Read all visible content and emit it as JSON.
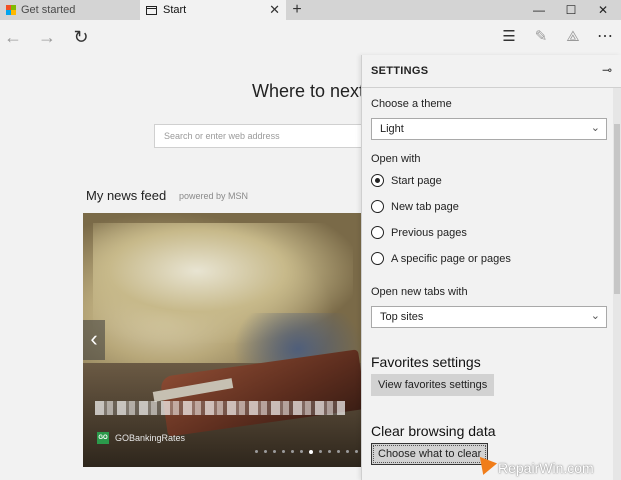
{
  "tabs": [
    {
      "label": "Get started"
    },
    {
      "label": "Start"
    }
  ],
  "window_controls": {
    "minimize": "—",
    "maximize": "☐",
    "close": "✕"
  },
  "newtab_glyph": "+",
  "start_page": {
    "heading": "Where to next?",
    "search_placeholder": "Search or enter web address",
    "feed_title": "My news feed",
    "powered_by": "powered by MSN",
    "hero_source": "GOBankingRates",
    "hero_source_badge": "GO",
    "carousel": {
      "count": 14,
      "active": 6
    }
  },
  "settings": {
    "title": "SETTINGS",
    "theme_label": "Choose a theme",
    "theme_value": "Light",
    "open_with_label": "Open with",
    "open_with_options": [
      {
        "label": "Start page",
        "selected": true
      },
      {
        "label": "New tab page",
        "selected": false
      },
      {
        "label": "Previous pages",
        "selected": false
      },
      {
        "label": "A specific page or pages",
        "selected": false
      }
    ],
    "new_tabs_label": "Open new tabs with",
    "new_tabs_value": "Top sites",
    "favorites_heading": "Favorites settings",
    "favorites_button": "View favorites settings",
    "clear_heading": "Clear browsing data",
    "clear_button": "Choose what to clear"
  },
  "watermark": "RepairWin.com",
  "colors": {
    "tab_strip": "#d4d4d4",
    "chrome": "#f2f2f2",
    "button_gray": "#d2d2d2",
    "cursor_orange": "#f07d1a",
    "ms_red": "#f25022",
    "ms_green": "#7fba00",
    "ms_blue": "#00a4ef",
    "ms_yellow": "#ffb900"
  },
  "icons": [
    "ms-logo-icon",
    "page-icon",
    "close-icon",
    "plus-icon",
    "back-icon",
    "forward-icon",
    "refresh-icon",
    "hub-icon",
    "web-note-icon",
    "share-icon",
    "more-icon",
    "pin-icon",
    "chevron-down-icon",
    "chevron-left-icon"
  ]
}
